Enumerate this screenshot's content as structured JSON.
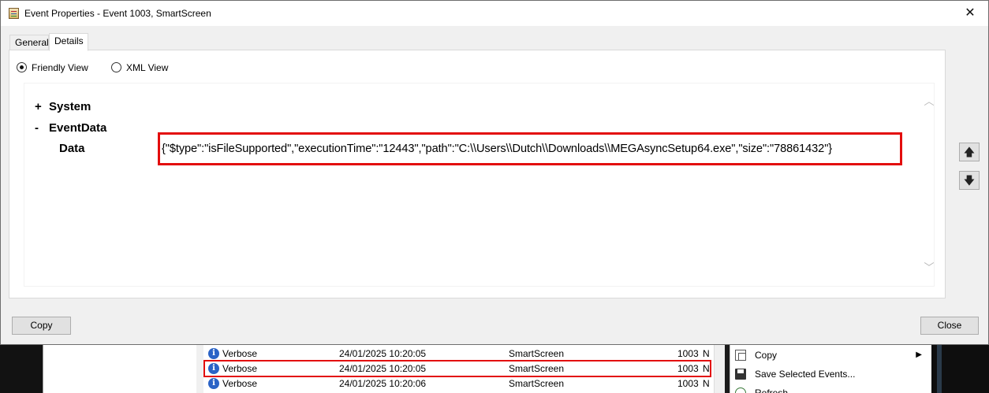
{
  "dialog": {
    "title": "Event Properties - Event 1003, SmartScreen",
    "close_glyph": "✕",
    "tabs": [
      {
        "label": "General",
        "active": false
      },
      {
        "label": "Details",
        "active": true
      }
    ],
    "view_options": [
      {
        "label": "Friendly View",
        "selected": true
      },
      {
        "label": "XML View",
        "selected": false
      }
    ],
    "tree": {
      "system": {
        "sign": "+",
        "label": "System"
      },
      "eventdata": {
        "sign": "-",
        "label": "EventData"
      },
      "data_label": "Data",
      "data_value": "{\"$type\":\"isFileSupported\",\"executionTime\":\"12443\",\"path\":\"C:\\\\Users\\\\Dutch\\\\Downloads\\\\MEGAsyncSetup64.exe\",\"size\":\"78861432\"}"
    },
    "nav": {
      "up_icon": "up-arrow-icon",
      "down_icon": "down-arrow-icon"
    },
    "buttons": {
      "copy": "Copy",
      "close": "Close"
    }
  },
  "background": {
    "events": [
      {
        "level": "Verbose",
        "datetime": "24/01/2025 10:20:05",
        "source": "SmartScreen",
        "event_id": "1003",
        "extra": "N"
      },
      {
        "level": "Verbose",
        "datetime": "24/01/2025 10:20:05",
        "source": "SmartScreen",
        "event_id": "1003",
        "extra": "N"
      },
      {
        "level": "Verbose",
        "datetime": "24/01/2025 10:20:06",
        "source": "SmartScreen",
        "event_id": "1003",
        "extra": "N"
      }
    ],
    "actions": [
      {
        "label": "Copy",
        "icon": "copy-icon",
        "has_submenu": true
      },
      {
        "label": "Save Selected Events...",
        "icon": "save-icon",
        "has_submenu": false
      },
      {
        "label": "Refresh",
        "icon": "refresh-icon",
        "has_submenu": false
      }
    ]
  },
  "colors": {
    "highlight": "#e30d0d",
    "info_icon": "#2b63c6"
  }
}
